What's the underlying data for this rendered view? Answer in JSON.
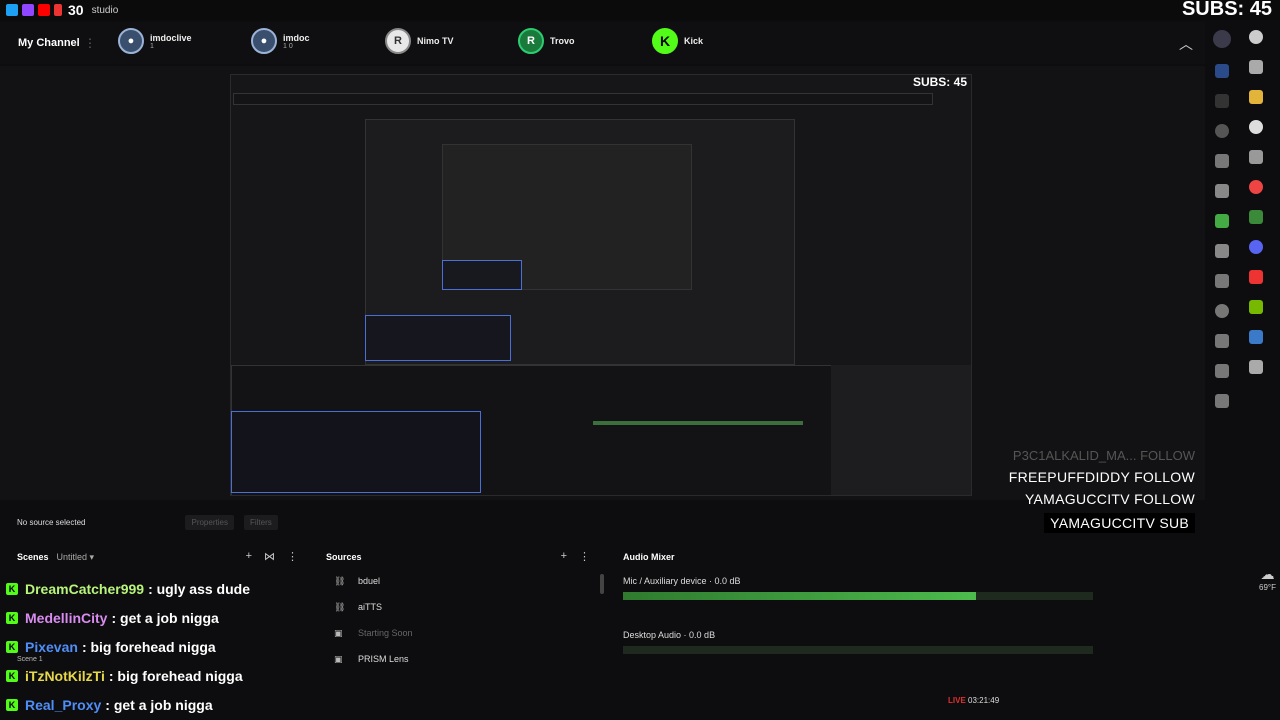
{
  "titlebar": {
    "count": "30",
    "app_name": "studio",
    "subs_counter": "SUBS: 45"
  },
  "channels": {
    "my_channel": "My Channel",
    "items": [
      {
        "name": "imdoclive",
        "stats": "1",
        "icon": "avatar-icon"
      },
      {
        "name": "imdoc",
        "stats": "1  0",
        "icon": "avatar-icon"
      },
      {
        "name": "Nimo TV",
        "stats": "",
        "icon": "nimo-icon",
        "letter": "R"
      },
      {
        "name": "Trovo",
        "stats": "",
        "icon": "trovo-icon",
        "letter": "R"
      },
      {
        "name": "Kick",
        "stats": "",
        "icon": "kick-icon",
        "letter": "K"
      }
    ]
  },
  "preview": {
    "subs_inner": "SUBS: 45",
    "alerts": {
      "ghost": "P3C1ALKALID_MA... FOLLOW",
      "lines": [
        {
          "user": "FREEPUFFDIDDY",
          "action": "FOLLOW"
        },
        {
          "user": "YAMAGUCCITV",
          "action": "FOLLOW"
        },
        {
          "user": "YAMAGUCCITV",
          "action": "SUB"
        }
      ]
    }
  },
  "sourcebar": {
    "no_source": "No source selected",
    "properties": "Properties",
    "filters": "Filters"
  },
  "scenes": {
    "title": "Scenes",
    "collection": "Untitled",
    "scene_label": "Scene 1"
  },
  "chat": [
    {
      "user": "DreamCatcher999",
      "color": "#b8f57a",
      "message": ": ugly ass dude"
    },
    {
      "user": "MedellinCity",
      "color": "#d98cf0",
      "message": ": get a job nigga"
    },
    {
      "user": "Pixevan",
      "color": "#4f8ef7",
      "message": ": big forehead nigga"
    },
    {
      "user": "iTzNotKilzTi",
      "color": "#e6d84a",
      "message": ": big forehead nigga"
    },
    {
      "user": "Real_Proxy",
      "color": "#4f8ef7",
      "message": ": get a job nigga"
    }
  ],
  "sources": {
    "title": "Sources",
    "items": [
      {
        "label": "bduel",
        "icon": "link-icon",
        "dim": false
      },
      {
        "label": "aiTTS",
        "icon": "link-icon",
        "dim": false
      },
      {
        "label": "Starting Soon",
        "icon": "scene-icon",
        "dim": true
      },
      {
        "label": "PRISM Lens",
        "icon": "camera-icon",
        "dim": false
      }
    ]
  },
  "mixer": {
    "title": "Audio Mixer",
    "tracks": [
      {
        "name": "Mic / Auxiliary device",
        "db": "0.0 dB",
        "level": 0.75
      },
      {
        "name": "Desktop Audio",
        "db": "0.0 dB",
        "level": 0.0
      }
    ]
  },
  "status": {
    "live": "LIVE",
    "time": "03:21:49"
  },
  "weather": {
    "temp": "69°F"
  }
}
